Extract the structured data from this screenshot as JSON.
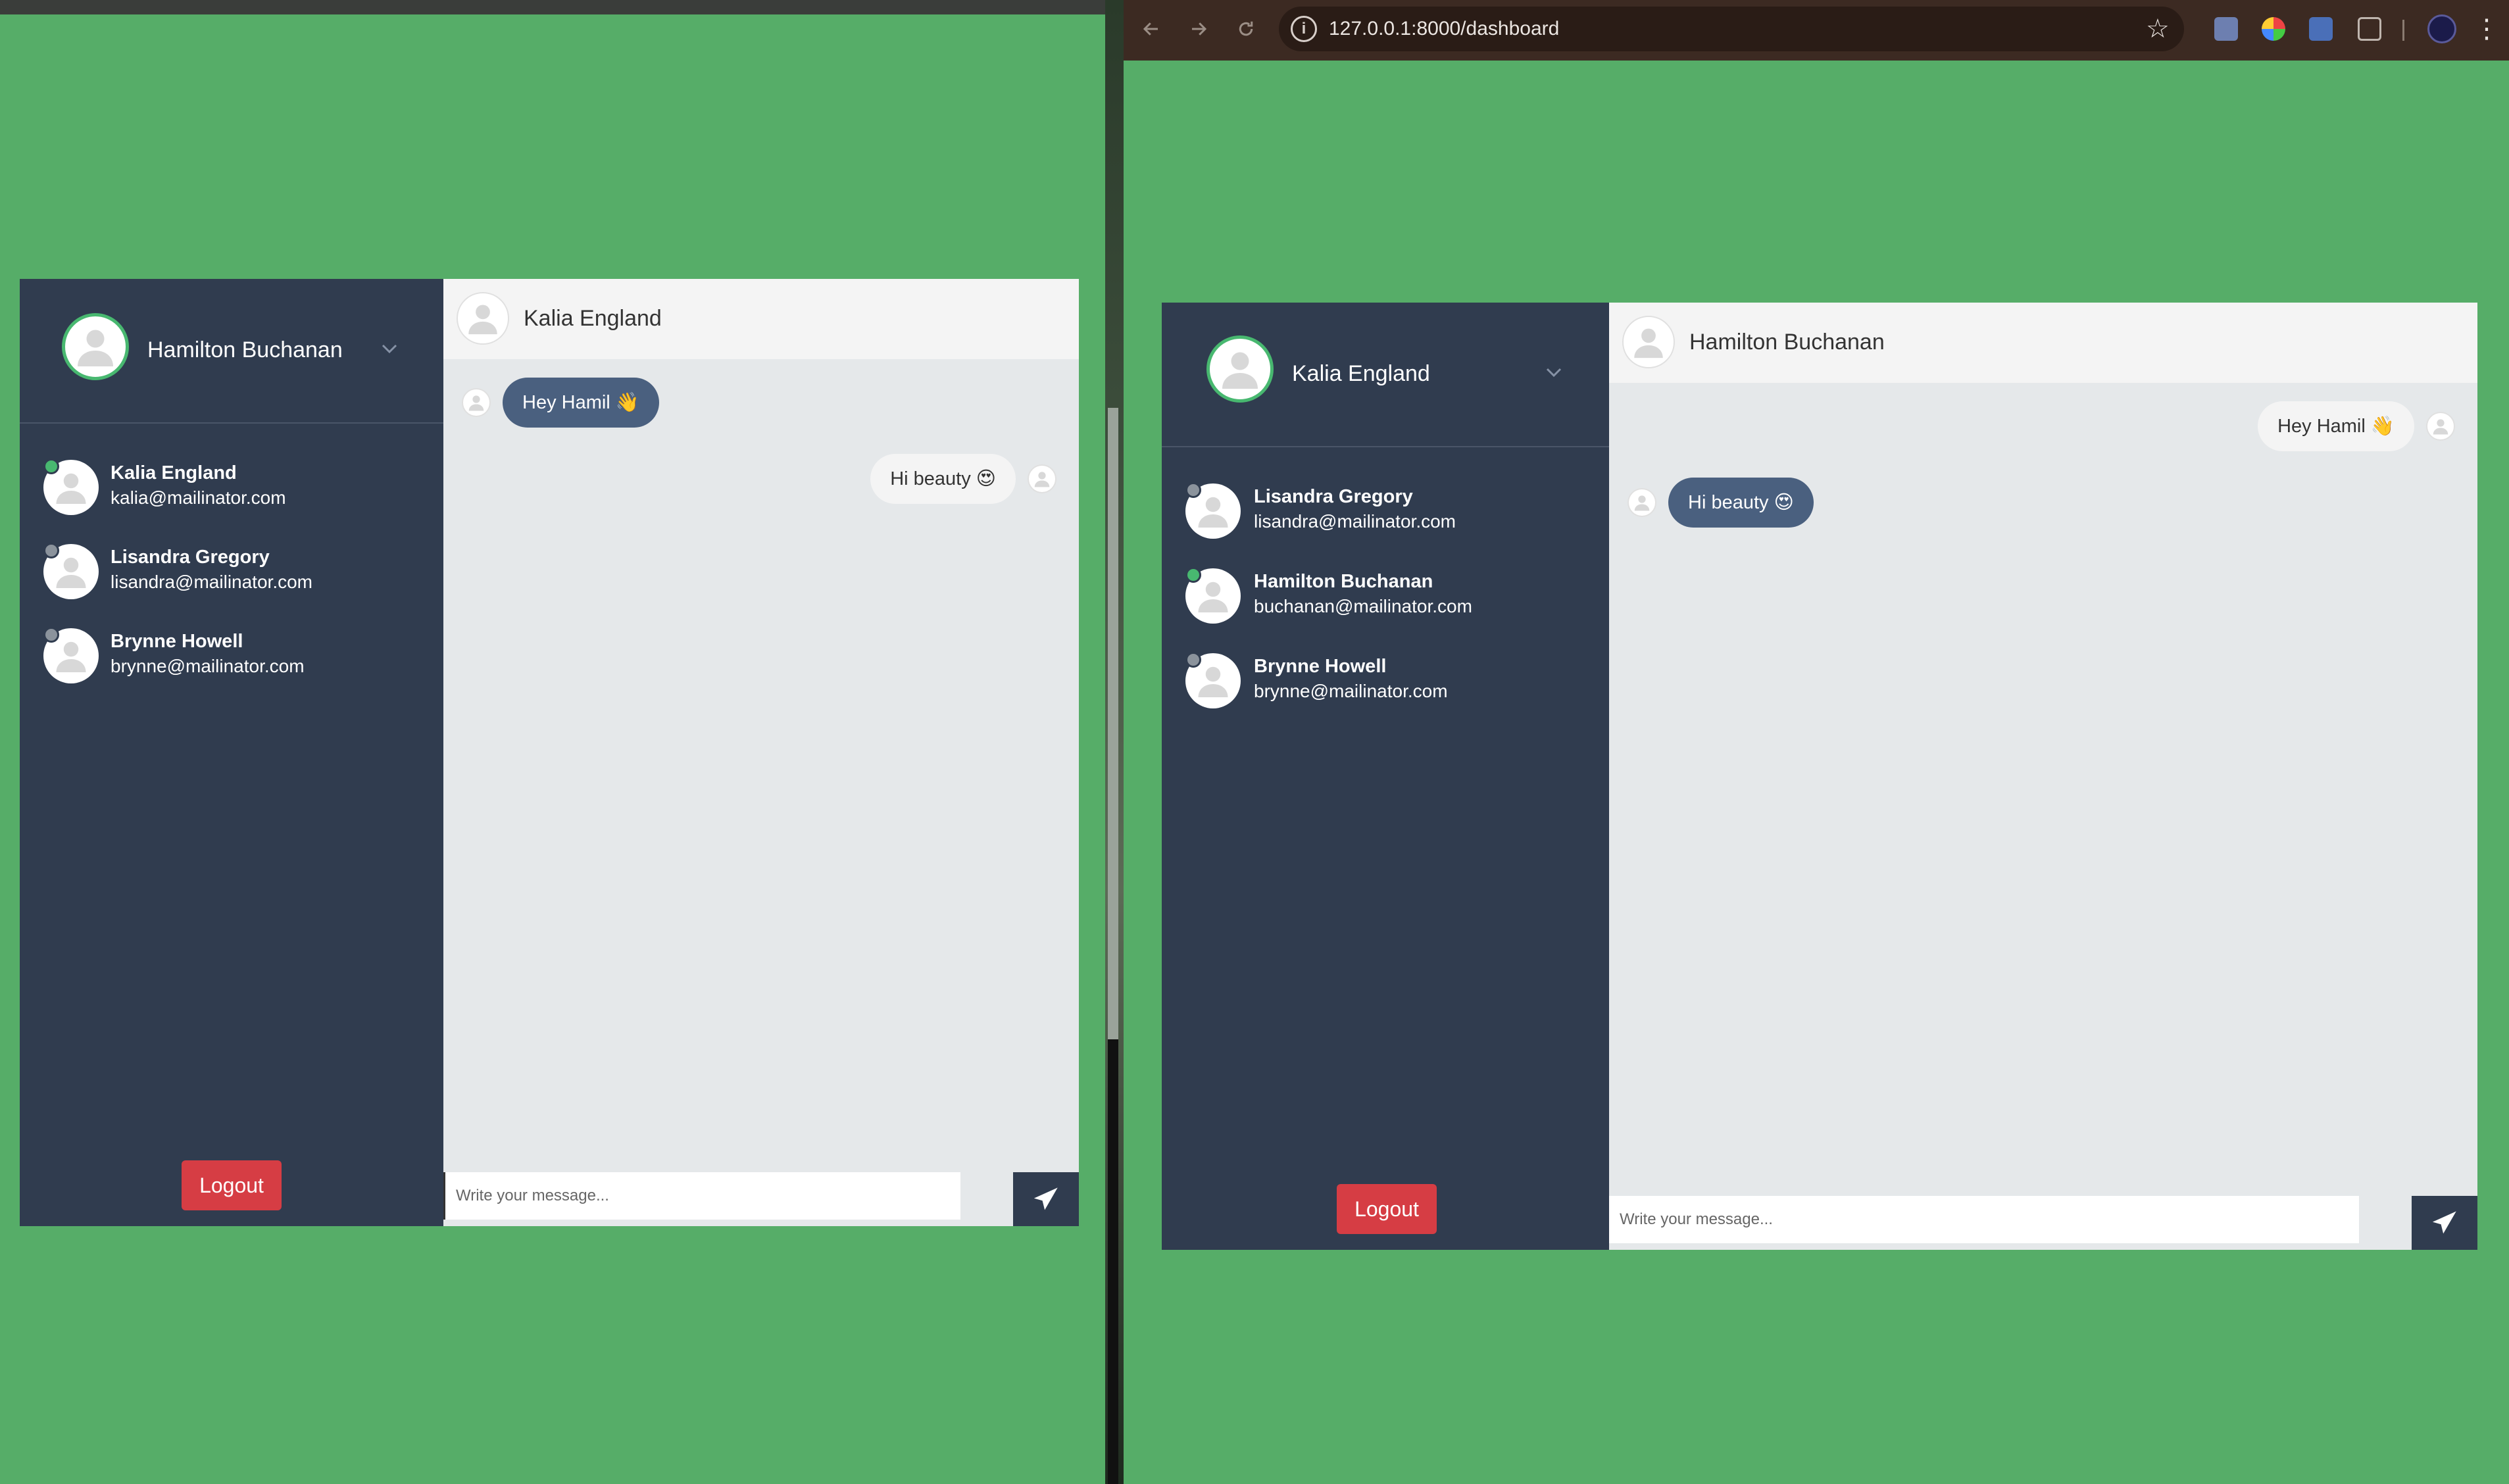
{
  "browser": {
    "url": "127.0.0.1:8000/dashboard"
  },
  "left_app": {
    "current_user": {
      "name": "Hamilton Buchanan"
    },
    "contacts": [
      {
        "name": "Kalia England",
        "email": "kalia@mailinator.com",
        "online": true
      },
      {
        "name": "Lisandra Gregory",
        "email": "lisandra@mailinator.com",
        "online": false
      },
      {
        "name": "Brynne Howell",
        "email": "brynne@mailinator.com",
        "online": false
      }
    ],
    "logout_label": "Logout",
    "chat": {
      "partner_name": "Kalia England",
      "messages": [
        {
          "text": "Hey Hamil 👋",
          "from_me": false
        },
        {
          "text": "Hi beauty 😍",
          "from_me": true
        }
      ],
      "input_placeholder": "Write your message..."
    }
  },
  "right_app": {
    "current_user": {
      "name": "Kalia England"
    },
    "contacts": [
      {
        "name": "Lisandra Gregory",
        "email": "lisandra@mailinator.com",
        "online": false
      },
      {
        "name": "Hamilton Buchanan",
        "email": "buchanan@mailinator.com",
        "online": true
      },
      {
        "name": "Brynne Howell",
        "email": "brynne@mailinator.com",
        "online": false
      }
    ],
    "logout_label": "Logout",
    "chat": {
      "partner_name": "Hamilton Buchanan",
      "messages": [
        {
          "text": "Hey Hamil 👋",
          "from_me": true
        },
        {
          "text": "Hi beauty 😍",
          "from_me": false
        }
      ],
      "input_placeholder": "Write your message..."
    }
  },
  "colors": {
    "desktop_bg": "#56ad68",
    "sidebar_bg": "#303c4f",
    "online": "#48b870",
    "offline": "#8b939c",
    "logout": "#d63d44",
    "bubble_dark": "#4a607f"
  },
  "icons": {
    "back": "back-arrow-icon",
    "forward": "forward-arrow-icon",
    "reload": "reload-icon",
    "info": "site-info-icon",
    "star": "bookmark-star-icon",
    "menu": "kebab-menu-icon",
    "send": "paper-plane-icon",
    "avatar": "user-placeholder-icon",
    "chevron": "chevron-down-icon"
  }
}
